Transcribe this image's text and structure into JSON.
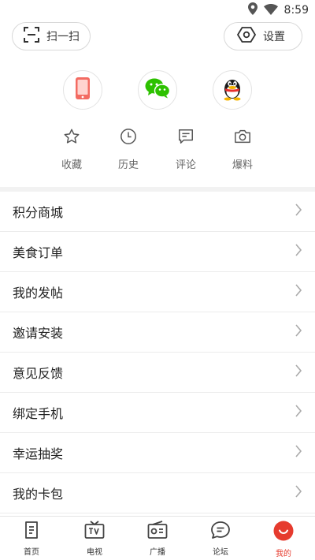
{
  "status_bar": {
    "time": "8:59",
    "icons": [
      "location-icon",
      "wifi-icon"
    ]
  },
  "header": {
    "scan_label": "扫一扫",
    "settings_label": "设置"
  },
  "login_options": [
    "phone-login-icon",
    "wechat-login-icon",
    "qq-login-icon"
  ],
  "quick_actions": [
    {
      "label": "收藏",
      "icon": "star-icon"
    },
    {
      "label": "历史",
      "icon": "clock-icon"
    },
    {
      "label": "评论",
      "icon": "comment-icon"
    },
    {
      "label": "爆料",
      "icon": "camera-icon"
    }
  ],
  "menu": [
    {
      "label": "积分商城"
    },
    {
      "label": "美食订单"
    },
    {
      "label": "我的发帖"
    },
    {
      "label": "邀请安装"
    },
    {
      "label": "意见反馈"
    },
    {
      "label": "绑定手机"
    },
    {
      "label": "幸运抽奖"
    },
    {
      "label": "我的卡包"
    }
  ],
  "tabs": [
    {
      "label": "首页",
      "icon": "home-doc-icon"
    },
    {
      "label": "电视",
      "icon": "tv-icon"
    },
    {
      "label": "广播",
      "icon": "radio-icon"
    },
    {
      "label": "论坛",
      "icon": "forum-icon"
    },
    {
      "label": "我的",
      "icon": "profile-icon",
      "active": true
    }
  ],
  "colors": {
    "accent": "#e63b2e",
    "wechat": "#2dc100",
    "divider": "#f2f2f2"
  }
}
